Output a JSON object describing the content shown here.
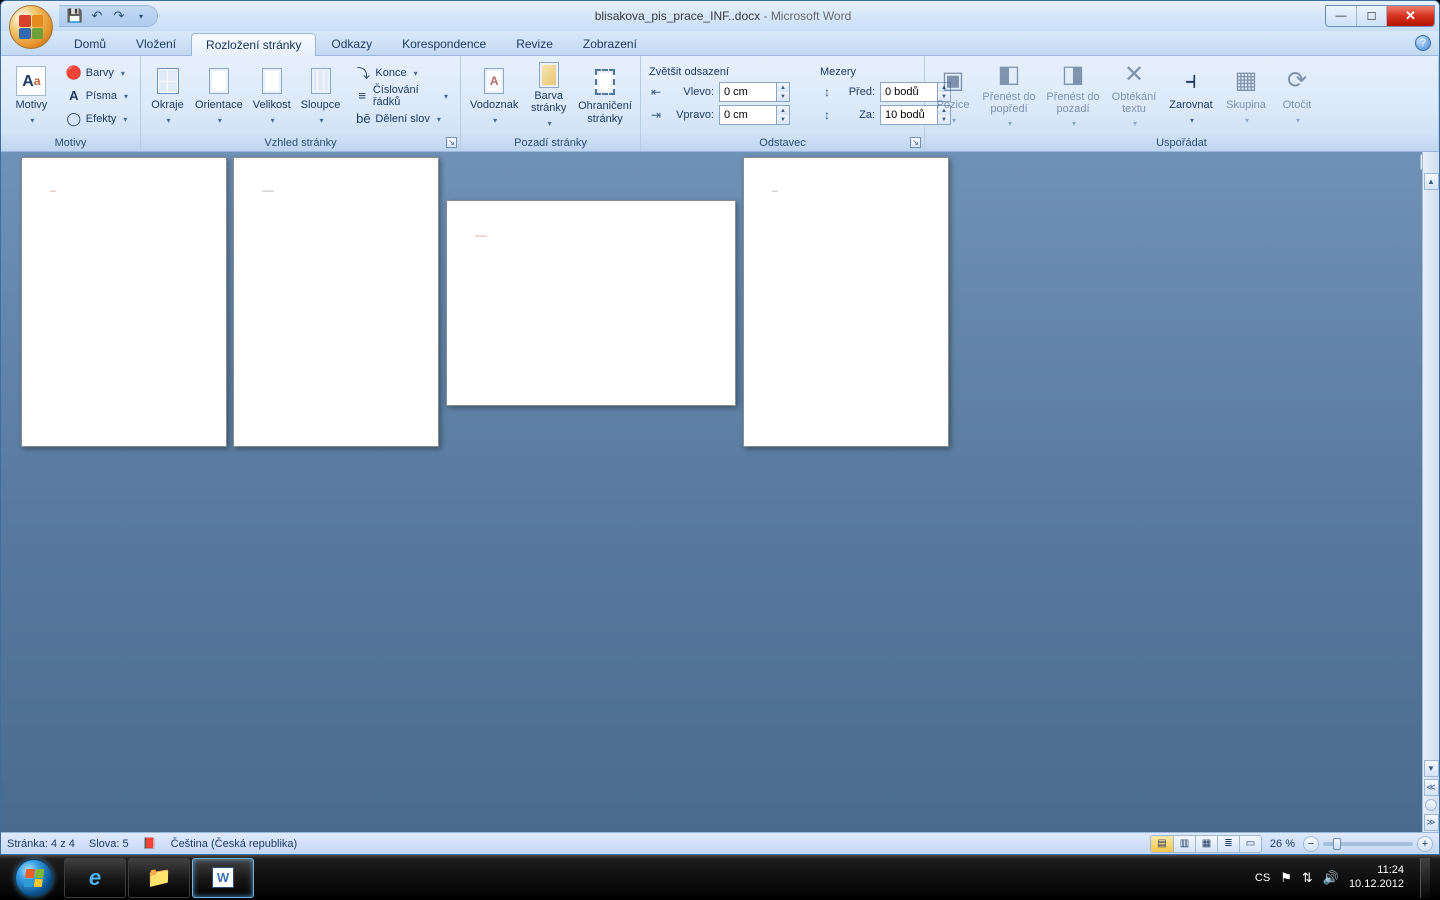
{
  "title": {
    "doc": "blisakova_pis_prace_INF..docx",
    "app": "Microsoft Word"
  },
  "tabs": [
    "Domů",
    "Vložení",
    "Rozložení stránky",
    "Odkazy",
    "Korespondence",
    "Revize",
    "Zobrazení"
  ],
  "active_tab": 2,
  "ribbon": {
    "motivy": {
      "label": "Motivy",
      "motivy": "Motivy",
      "barvy": "Barvy",
      "pisma": "Písma",
      "efekty": "Efekty"
    },
    "vzhled": {
      "label": "Vzhled stránky",
      "okraje": "Okraje",
      "orientace": "Orientace",
      "velikost": "Velikost",
      "sloupce": "Sloupce",
      "konce": "Konce",
      "cisla": "Číslování řádků",
      "deleni": "Dělení slov"
    },
    "pozadi": {
      "label": "Pozadí stránky",
      "vodoznak": "Vodoznak",
      "barva": "Barva stránky",
      "ohraniceni": "Ohraničení stránky"
    },
    "odstavec": {
      "label": "Odstavec",
      "odsazeni": "Zvětšit odsazení",
      "vlevo_l": "Vlevo:",
      "vpravo_l": "Vpravo:",
      "vlevo_v": "0 cm",
      "vpravo_v": "0 cm",
      "mezery": "Mezery",
      "pred_l": "Před:",
      "za_l": "Za:",
      "pred_v": "0 bodů",
      "za_v": "10 bodů"
    },
    "usporadat": {
      "label": "Uspořádat",
      "pozice": "Pozice",
      "dopredu": "Přenést do popředí",
      "dozadu": "Přenést do pozadí",
      "obtekani": "Obtékání textu",
      "zarovnat": "Zarovnat",
      "skupina": "Skupina",
      "otocit": "Otočit"
    }
  },
  "status": {
    "stranka": "Stránka: 4 z 4",
    "slova": "Slova: 5",
    "jazyk": "Čeština (Česká republika)",
    "zoom": "26 %"
  },
  "tray": {
    "lang": "CS",
    "time": "11:24",
    "date": "10.12.2012"
  }
}
